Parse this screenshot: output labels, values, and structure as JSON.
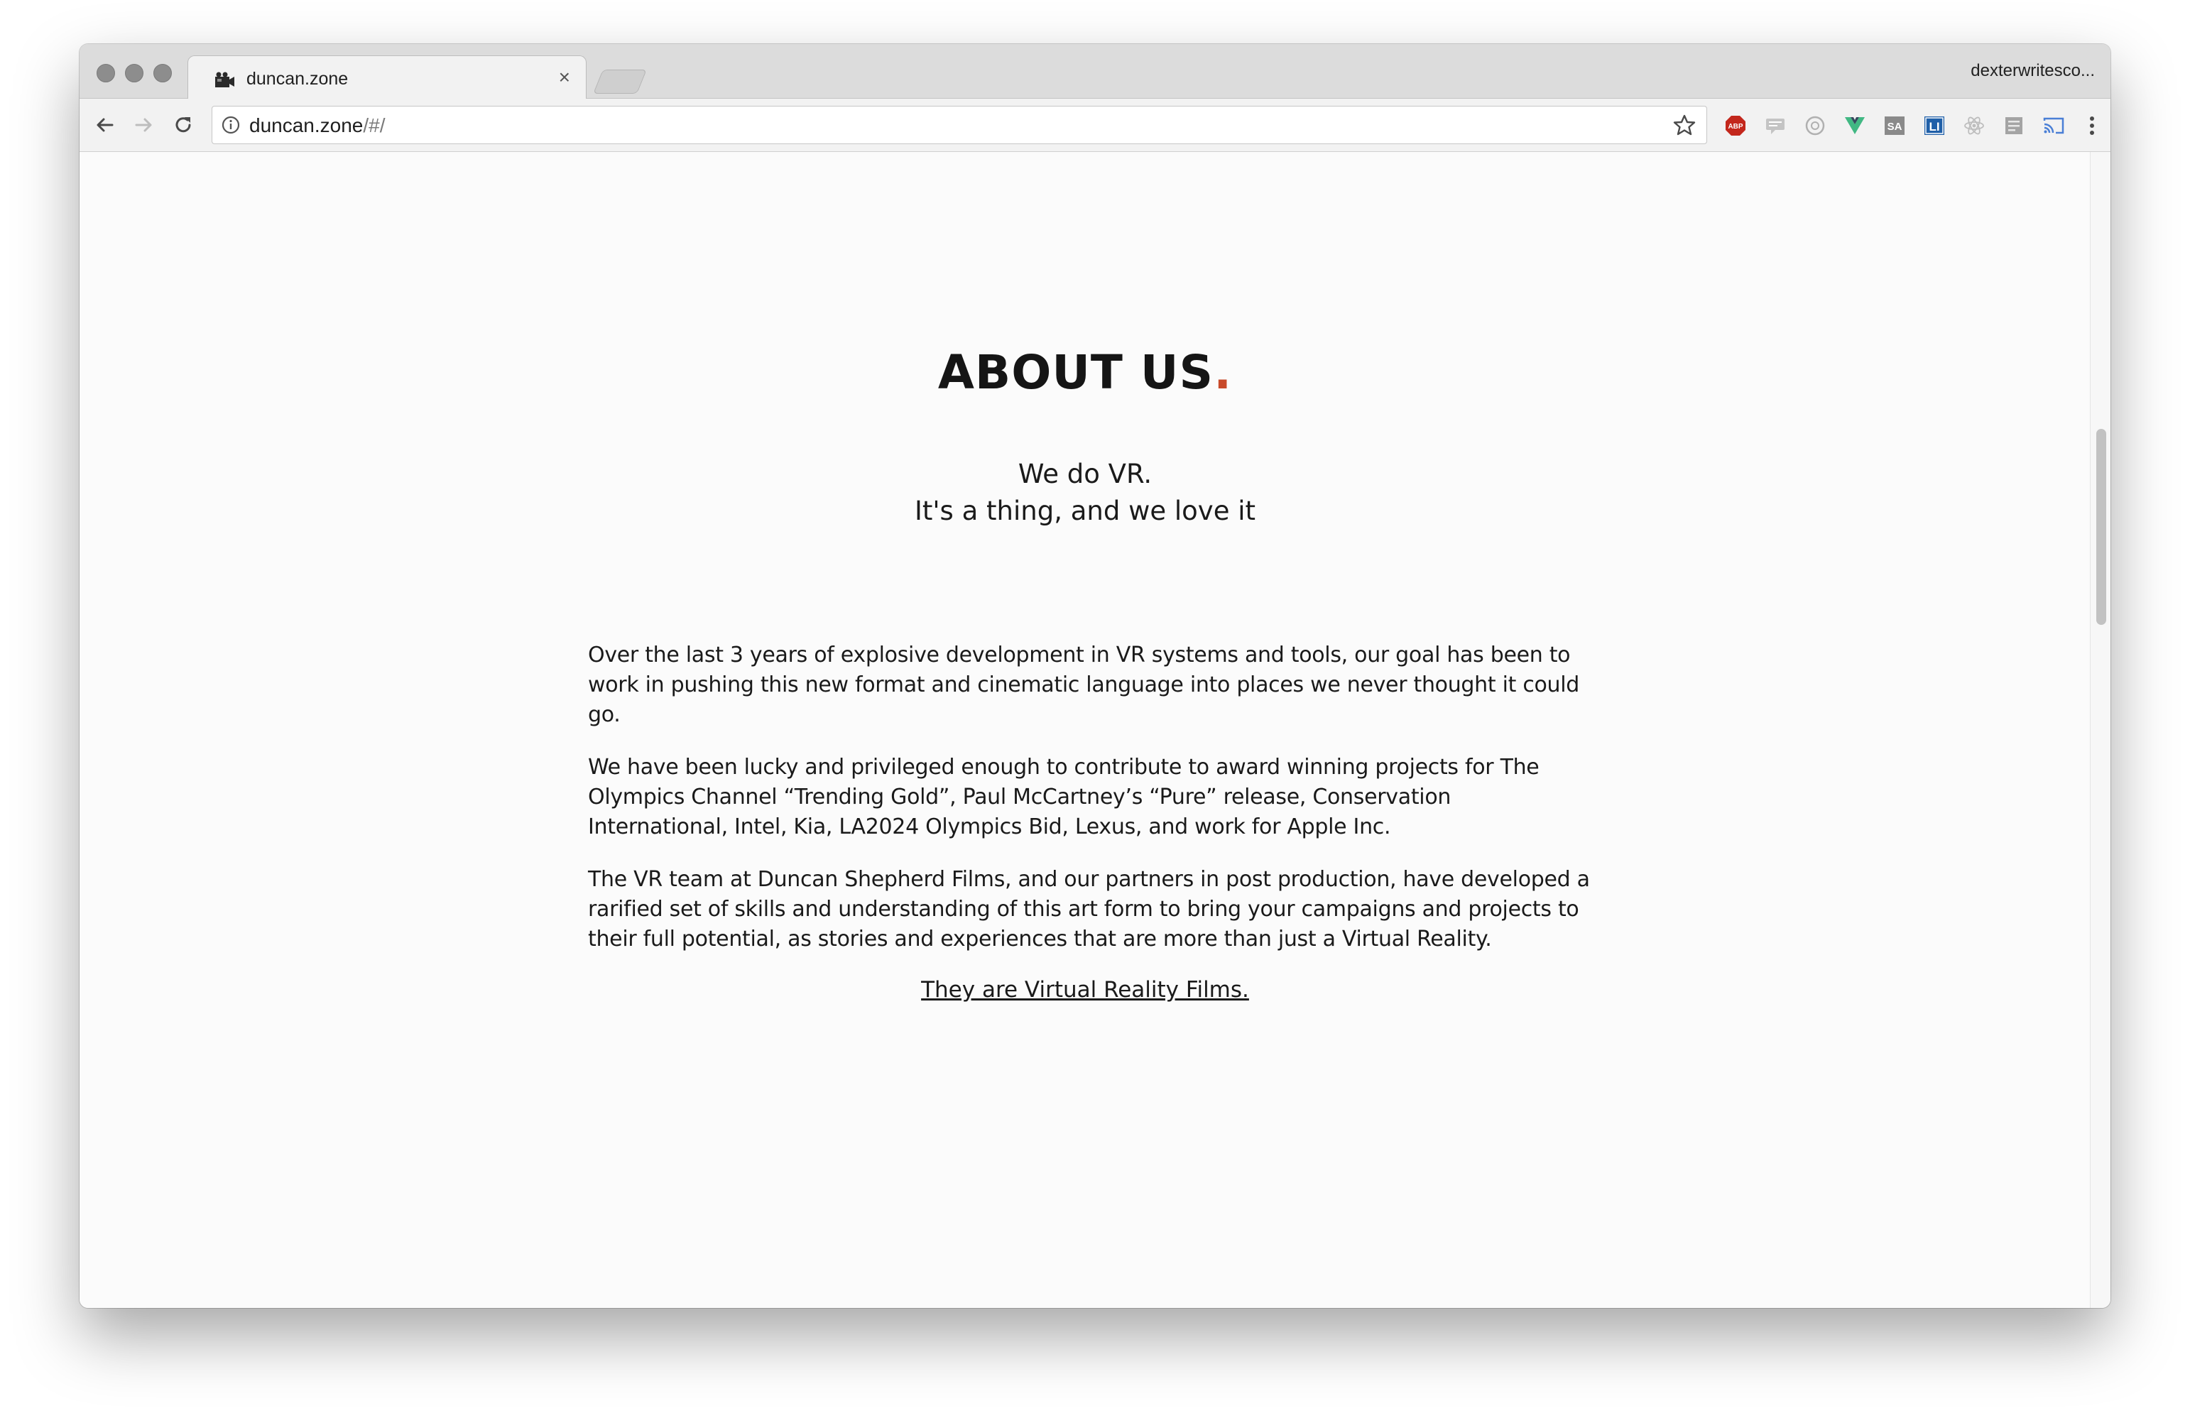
{
  "browser": {
    "tab": {
      "title": "duncan.zone",
      "close_glyph": "×"
    },
    "profile_name": "dexterwritesco...",
    "omnibox": {
      "host": "duncan.zone",
      "path": "/#/"
    },
    "extensions": [
      {
        "name": "adblock-plus-icon",
        "label": "ABP",
        "color": "#c3271c"
      },
      {
        "name": "speech-bubble-icon",
        "color": "#b9b9b9"
      },
      {
        "name": "circle-extension-icon",
        "color": "#b9b9b9"
      },
      {
        "name": "vue-devtools-icon",
        "color": "#41b883"
      },
      {
        "name": "sa-extension-icon",
        "label": "SA",
        "color": "#8a8a8a"
      },
      {
        "name": "li-extension-icon",
        "label": "LI",
        "color": "#1f5fa8"
      },
      {
        "name": "react-devtools-icon",
        "color": "#b9b9b9"
      },
      {
        "name": "reader-extension-icon",
        "color": "#9a9a9a"
      },
      {
        "name": "cast-icon",
        "color": "#4a7fd6"
      }
    ]
  },
  "page": {
    "title": "ABOUT US",
    "title_dot": ".",
    "title_dot_color": "#c84a2a",
    "tagline_1": "We do VR.",
    "tagline_2": "It's a thing, and we love it",
    "paragraphs": [
      "Over the last 3 years of explosive development in VR systems and tools, our goal has been to work in pushing this new format and cinematic language into places we never thought it could go.",
      "We have been lucky and privileged enough to contribute to award winning projects for The Olympics Channel “Trending Gold”, Paul McCartney’s “Pure” release, Conservation International, Intel, Kia, LA2024 Olympics Bid, Lexus, and work for Apple Inc.",
      "The VR team at Duncan Shepherd Films, and our partners in post production, have developed a rarified set of skills and understanding of this art form to bring your campaigns and projects to their full potential, as stories and experiences that are more than just a Virtual Reality."
    ],
    "closing_link": "They are Virtual Reality Films."
  }
}
